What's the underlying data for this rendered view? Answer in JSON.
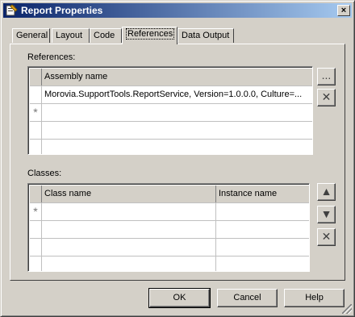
{
  "window": {
    "title": "Report Properties",
    "close_label": "×"
  },
  "tabs": [
    {
      "label": "General"
    },
    {
      "label": "Layout"
    },
    {
      "label": "Code"
    },
    {
      "label": "References"
    },
    {
      "label": "Data Output"
    }
  ],
  "references": {
    "label": "References:",
    "column": "Assembly name",
    "rows": [
      "Morovia.SupportTools.ReportService, Version=1.0.0.0, Culture=..."
    ],
    "new_row_marker": "*",
    "browse_label": "...",
    "delete_label": "✕"
  },
  "classes": {
    "label": "Classes:",
    "columns": [
      "Class name",
      "Instance name"
    ],
    "new_row_marker": "*",
    "up_label": "▲",
    "down_label": "▼",
    "delete_label": "✕"
  },
  "buttons": {
    "ok": "OK",
    "cancel": "Cancel",
    "help": "Help"
  }
}
